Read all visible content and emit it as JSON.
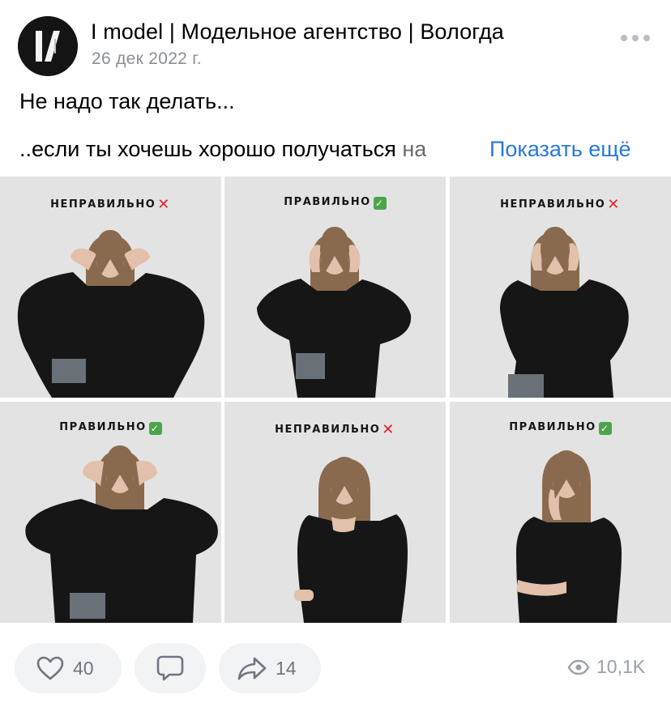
{
  "post": {
    "author": "I model | Модельное агентство | Вологда",
    "date": "26 дек 2022 г.",
    "line1": "Не надо так делать...",
    "line2": "..если ты хочешь хорошо получаться ",
    "line2_fade": "на",
    "show_more": "Показать ещё"
  },
  "photos": [
    {
      "label": "НЕПРАВИЛЬНО",
      "mark": "cross-mark-icon"
    },
    {
      "label": "ПРАВИЛЬНО",
      "mark": "check-mark-icon"
    },
    {
      "label": "НЕПРАВИЛЬНО",
      "mark": "cross-mark-icon"
    },
    {
      "label": "ПРАВИЛЬНО",
      "mark": "check-mark-icon"
    },
    {
      "label": "НЕПРАВИЛЬНО",
      "mark": "cross-mark-icon"
    },
    {
      "label": "ПРАВИЛЬНО",
      "mark": "check-mark-icon"
    }
  ],
  "actions": {
    "likes": "40",
    "reposts": "14",
    "views": "10,1K"
  },
  "colors": {
    "link": "#2a7ad6",
    "muted": "#8a8f96",
    "pill_bg": "#f2f3f5",
    "photo_bg": "#e3e3e3"
  }
}
